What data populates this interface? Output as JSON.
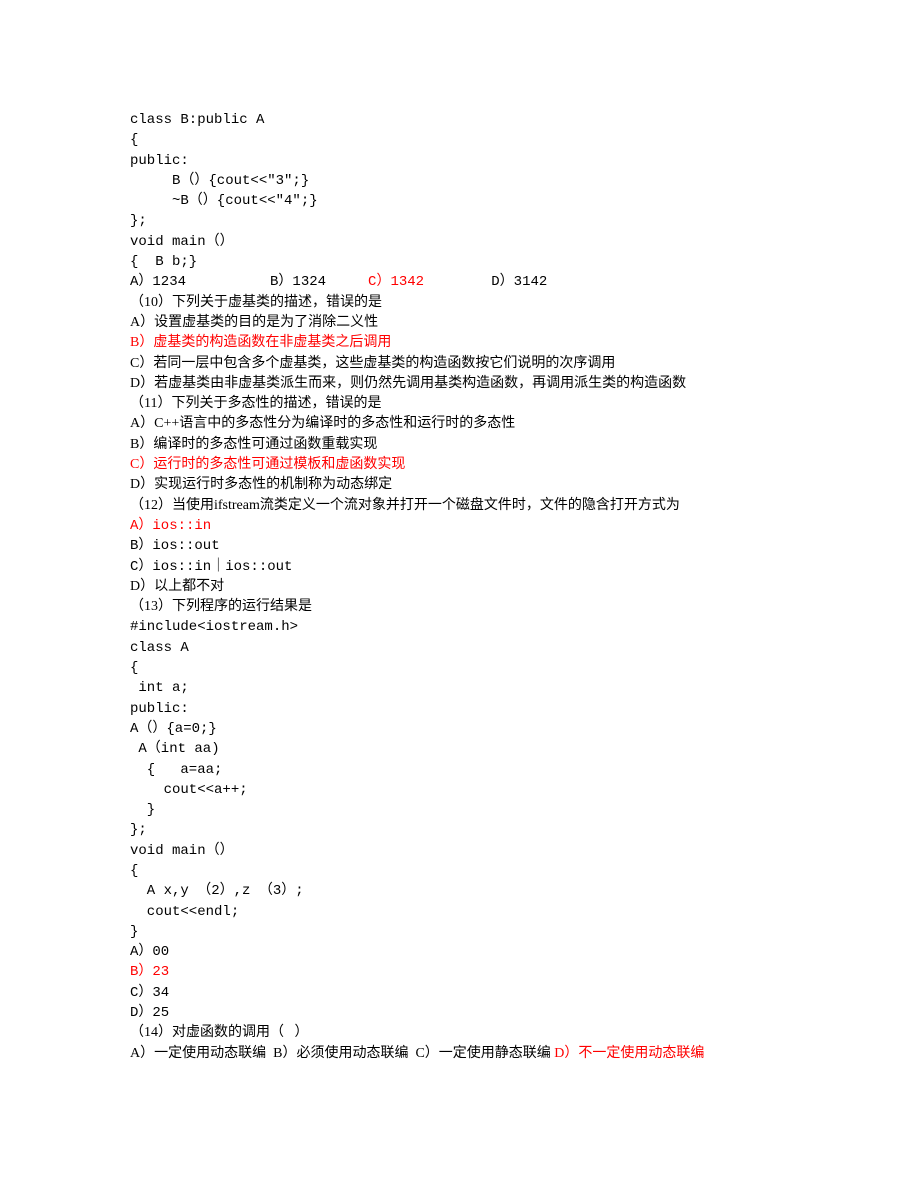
{
  "lines": [
    {
      "text": "class B:public A",
      "class": "mono"
    },
    {
      "text": "{",
      "class": "mono"
    },
    {
      "text": "public:",
      "class": "mono"
    },
    {
      "text": "     B（）{cout<<\"3\";}",
      "class": "mono"
    },
    {
      "text": "     ~B（）{cout<<\"4\";}",
      "class": "mono"
    },
    {
      "text": "};",
      "class": "mono"
    },
    {
      "text": "void main（）",
      "class": "mono"
    },
    {
      "text": "{  B b;}",
      "class": "mono"
    },
    {
      "segments": [
        {
          "text": "A）1234          B）1324     ",
          "class": "mono"
        },
        {
          "text": "C）1342",
          "class": "mono red"
        },
        {
          "text": "        D）3142",
          "class": "mono"
        }
      ]
    },
    {
      "text": "（10）下列关于虚基类的描述，错误的是"
    },
    {
      "text": "A）设置虚基类的目的是为了消除二义性"
    },
    {
      "text": "B）虚基类的构造函数在非虚基类之后调用",
      "class": "red"
    },
    {
      "text": "C）若同一层中包含多个虚基类，这些虚基类的构造函数按它们说明的次序调用"
    },
    {
      "text": "D）若虚基类由非虚基类派生而来，则仍然先调用基类构造函数，再调用派生类的构造函数"
    },
    {
      "text": "（11）下列关于多态性的描述，错误的是"
    },
    {
      "text": "A）C++语言中的多态性分为编译时的多态性和运行时的多态性"
    },
    {
      "text": "B）编译时的多态性可通过函数重载实现"
    },
    {
      "text": "C）运行时的多态性可通过模板和虚函数实现",
      "class": "red"
    },
    {
      "text": "D）实现运行时多态性的机制称为动态绑定"
    },
    {
      "text": "（12）当使用ifstream流类定义一个流对象并打开一个磁盘文件时，文件的隐含打开方式为"
    },
    {
      "text": "A）ios::in",
      "class": "mono red"
    },
    {
      "text": "B）ios::out",
      "class": "mono"
    },
    {
      "text": "C）ios::in｜ios::out",
      "class": "mono"
    },
    {
      "text": "D）以上都不对"
    },
    {
      "text": "（13）下列程序的运行结果是"
    },
    {
      "text": "#include<iostream.h>",
      "class": "mono"
    },
    {
      "text": "class A",
      "class": "mono"
    },
    {
      "text": "{",
      "class": "mono"
    },
    {
      "text": " int a;",
      "class": "mono"
    },
    {
      "text": "public:",
      "class": "mono"
    },
    {
      "text": "A（）{a=0;}",
      "class": "mono"
    },
    {
      "text": " A（int aa)",
      "class": "mono"
    },
    {
      "text": "  {   a=aa;",
      "class": "mono"
    },
    {
      "text": "    cout<<a++;",
      "class": "mono"
    },
    {
      "text": "  }",
      "class": "mono"
    },
    {
      "text": "};",
      "class": "mono"
    },
    {
      "text": "void main（）",
      "class": "mono"
    },
    {
      "text": "{",
      "class": "mono"
    },
    {
      "text": "  A x,y （2）,z （3）;",
      "class": "mono"
    },
    {
      "text": "  cout<<endl;",
      "class": "mono"
    },
    {
      "text": "}",
      "class": "mono"
    },
    {
      "text": "A）00",
      "class": "mono"
    },
    {
      "text": "B）23",
      "class": "mono red"
    },
    {
      "text": "C）34",
      "class": "mono"
    },
    {
      "text": "D）25",
      "class": "mono"
    },
    {
      "text": "（14）对虚函数的调用（   ）"
    },
    {
      "segments": [
        {
          "text": "A）一定使用动态联编  B）必须使用动态联编  C）一定使用静态联编 "
        },
        {
          "text": "D）不一定使用动态联编",
          "class": "red"
        }
      ]
    }
  ]
}
